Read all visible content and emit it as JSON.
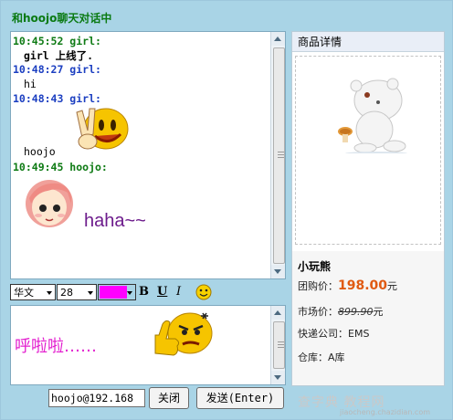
{
  "window": {
    "title": "和hoojo聊天对话中"
  },
  "chat": {
    "messages": [
      {
        "header": "10:45:52 girl:",
        "text": "girl 上线了."
      },
      {
        "header": "10:48:27 girl:",
        "text": "hi"
      },
      {
        "header": "10:48:43 girl:",
        "text": "hoojo"
      },
      {
        "header": "10:49:45 hoojo:",
        "text": "haha~~"
      }
    ]
  },
  "toolbar": {
    "font_value": "华文",
    "size_value": "28",
    "text_color": "#ff00ff",
    "bold": "B",
    "underline": "U",
    "italic": "I"
  },
  "input": {
    "text": "呼啦啦……"
  },
  "footer": {
    "address": "hoojo@192.168",
    "close_label": "关闭",
    "send_label": "发送(Enter)"
  },
  "product": {
    "heading": "商品详情",
    "name": "小玩熊",
    "group_label": "团购价：",
    "group_price": "198.00",
    "group_unit": "元",
    "market_label": "市场价：",
    "market_price": "899.90",
    "market_unit": "元",
    "express_label": "快递公司：",
    "express_value": "EMS",
    "warehouse_label": "仓库：",
    "warehouse_value": "A库"
  },
  "watermark": {
    "main": "查字典 教程网",
    "sub": "jiaocheng.chazidian.com"
  },
  "colors": {
    "header_green": "#0f7b15",
    "header_blue": "#1c3fc1",
    "price": "#e05a12",
    "frame": "#a9d4e6"
  }
}
